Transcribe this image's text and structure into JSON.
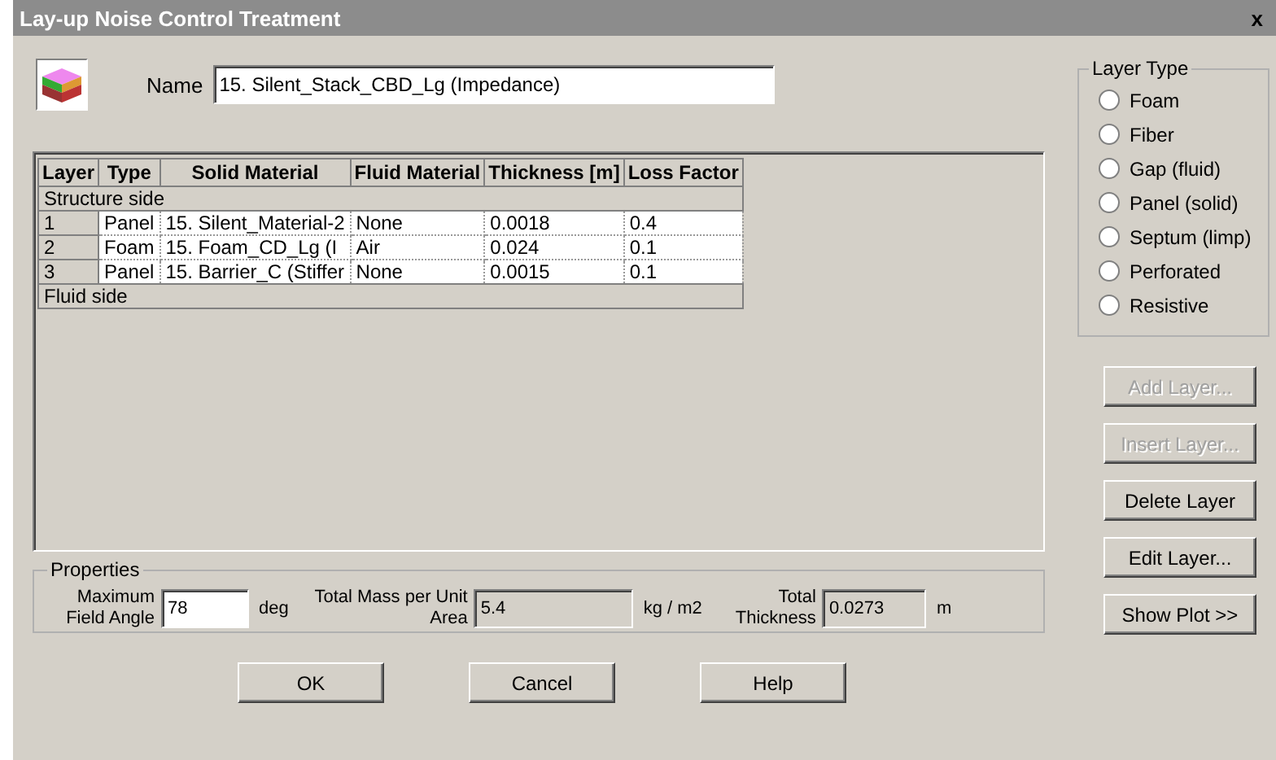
{
  "window": {
    "title": "Lay-up Noise Control Treatment",
    "close": "x"
  },
  "name": {
    "label": "Name",
    "value": "15. Silent_Stack_CBD_Lg (Impedance)"
  },
  "table": {
    "columns": [
      "Layer",
      "Type",
      "Solid Material",
      "Fluid Material",
      "Thickness [m]",
      "Loss Factor"
    ],
    "top_label": "Structure side",
    "rows": [
      {
        "layer": "1",
        "type": "Panel",
        "solid": "15. Silent_Material-2",
        "fluid": "None",
        "thickness": "0.0018",
        "loss": "0.4"
      },
      {
        "layer": "2",
        "type": "Foam",
        "solid": "15. Foam_CD_Lg (I",
        "fluid": "Air",
        "thickness": "0.024",
        "loss": "0.1"
      },
      {
        "layer": "3",
        "type": "Panel",
        "solid": "15. Barrier_C (Stiffer",
        "fluid": "None",
        "thickness": "0.0015",
        "loss": "0.1"
      }
    ],
    "bottom_label": "Fluid side"
  },
  "layer_type": {
    "title": "Layer Type",
    "options": [
      {
        "label": "Foam",
        "selected": false
      },
      {
        "label": "Fiber",
        "selected": false
      },
      {
        "label": "Gap (fluid)",
        "selected": false
      },
      {
        "label": "Panel (solid)",
        "selected": false
      },
      {
        "label": "Septum (limp)",
        "selected": false
      },
      {
        "label": "Perforated",
        "selected": false
      },
      {
        "label": "Resistive",
        "selected": false
      }
    ]
  },
  "side_buttons": [
    {
      "label": "Add Layer...",
      "disabled": true
    },
    {
      "label": "Insert Layer...",
      "disabled": true
    },
    {
      "label": "Delete Layer",
      "disabled": false
    },
    {
      "label": "Edit Layer...",
      "disabled": false
    },
    {
      "label": "Show Plot >>",
      "disabled": false
    }
  ],
  "properties": {
    "title": "Properties",
    "fields": [
      {
        "label": "Maximum Field Angle",
        "value": "78",
        "unit": "deg",
        "disabled": false
      },
      {
        "label": "Total Mass per Unit Area",
        "value": "5.4",
        "unit": "kg / m2",
        "disabled": true
      },
      {
        "label": "Total Thickness",
        "value": "0.0273",
        "unit": "m",
        "disabled": true
      }
    ]
  },
  "buttons": [
    "OK",
    "Cancel",
    "Help"
  ]
}
